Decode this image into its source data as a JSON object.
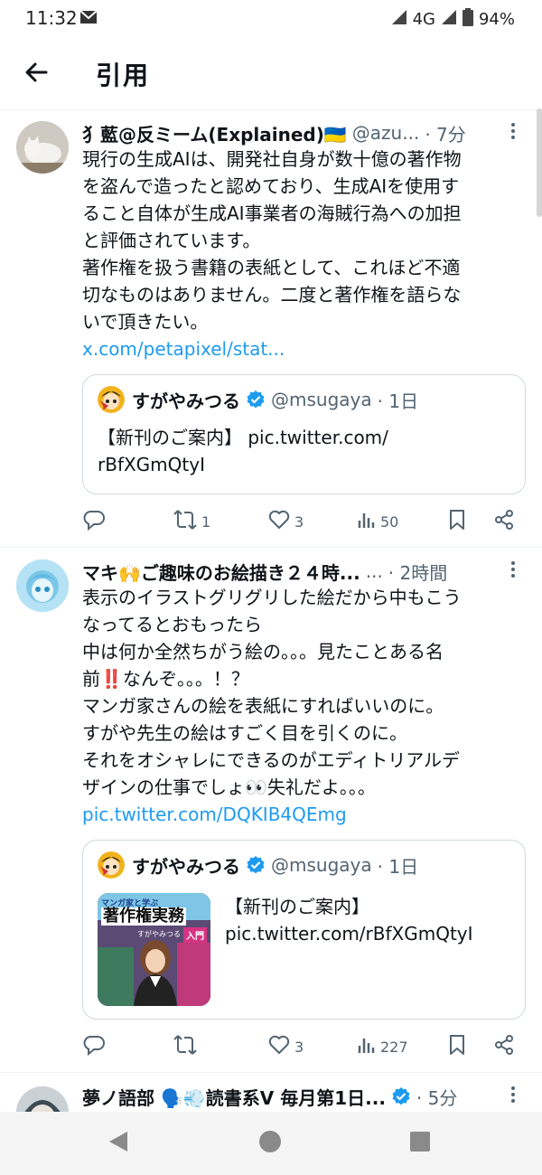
{
  "status": {
    "time": "11:32",
    "network": "4G",
    "battery": "94%"
  },
  "header": {
    "title": "引用"
  },
  "tweets": [
    {
      "author": "犭藍@反ミーム(Explained)🇺🇦",
      "handle": "@azu...",
      "time": "· 7分",
      "text": "現行の生成AIは、開発社自身が数十億の著作物\nを盗んで造ったと認めており、生成AIを使用す\nること自体が生成AI事業者の海賊行為への加担\nと評価されています。\n著作権を扱う書籍の表紙として、これほど不適\n切なものはありません。二度と著作権を語らな\nいで頂きたい。",
      "link": "x.com/petapixel/stat...",
      "quote": {
        "author": "すがやみつる",
        "handle": "@msugaya",
        "time": "· 1日",
        "text": "【新刊のご案内】 pic.twitter.com/\nrBfXGmQtyI"
      },
      "actions": {
        "reply": "",
        "retweet": "1",
        "like": "3",
        "views": "50"
      }
    },
    {
      "author": "マキ🙌ご趣味のお絵描き２４時...",
      "handle": "...",
      "time": "· 2時間",
      "text": "表示のイラストグリグリした絵だから中もこう\nなってるとおもったら\n中は何か全然ちがう絵の。。。見たことある名\n前‼️なんぞ。。。！？\nマンガ家さんの絵を表紙にすればいいのに。\nすがや先生の絵はすごく目を引くのに。\nそれをオシャレにできるのがエディトリアルデ\nザインの仕事でしょ👀失礼だよ。。。",
      "link": "pic.twitter.com/DQKIB4QEmg",
      "quote": {
        "author": "すがやみつる",
        "handle": "@msugaya",
        "time": "· 1日",
        "text": "【新刊のご案内】\npic.twitter.com/rBfXGmQtyI",
        "book": {
          "top": "マンガ家と学ぶ",
          "title": "著作権実務",
          "badge": "入門",
          "author": "すがやみつる"
        }
      },
      "actions": {
        "reply": "",
        "retweet": "",
        "like": "3",
        "views": "227"
      }
    },
    {
      "author": "夢ノ語部 🗣️💨読書系V 毎月第1日...",
      "time": "· 5分"
    }
  ],
  "colors": {
    "accent": "#1d9bf0",
    "text": "#0f1419",
    "muted": "#536471",
    "border": "#cfd9de"
  },
  "icons": [
    "back-arrow-icon",
    "more-icon",
    "reply-icon",
    "retweet-icon",
    "like-icon",
    "views-icon",
    "bookmark-icon",
    "share-icon",
    "verified-icon"
  ]
}
